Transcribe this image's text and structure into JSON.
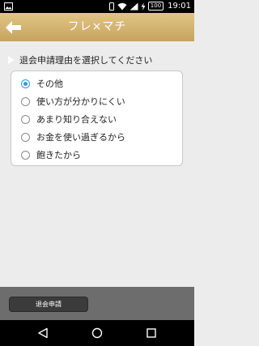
{
  "status_bar": {
    "time": "19:01",
    "battery": "100",
    "icons": [
      "notification-image-icon",
      "vibrate-icon",
      "wifi-icon",
      "cell-signal-icon",
      "charging-bolt-icon"
    ]
  },
  "header": {
    "title": "フレ×マチ",
    "back_icon": "back-arrow-icon"
  },
  "section": {
    "label": "退会申請理由を選択してください"
  },
  "options": [
    {
      "label": "その他",
      "checked": true
    },
    {
      "label": "使い方が分かりにくい",
      "checked": false
    },
    {
      "label": "あまり知り合えない",
      "checked": false
    },
    {
      "label": "お金を使い過ぎるから",
      "checked": false
    },
    {
      "label": "飽きたから",
      "checked": false
    }
  ],
  "footer": {
    "submit_label": "退会申請"
  },
  "nav": {
    "icons": [
      "back-triangle-icon",
      "home-circle-icon",
      "recents-square-icon"
    ]
  },
  "colors": {
    "header_gold": "#c6a45f",
    "radio_accent": "#2e9be0",
    "background": "#ececec"
  }
}
